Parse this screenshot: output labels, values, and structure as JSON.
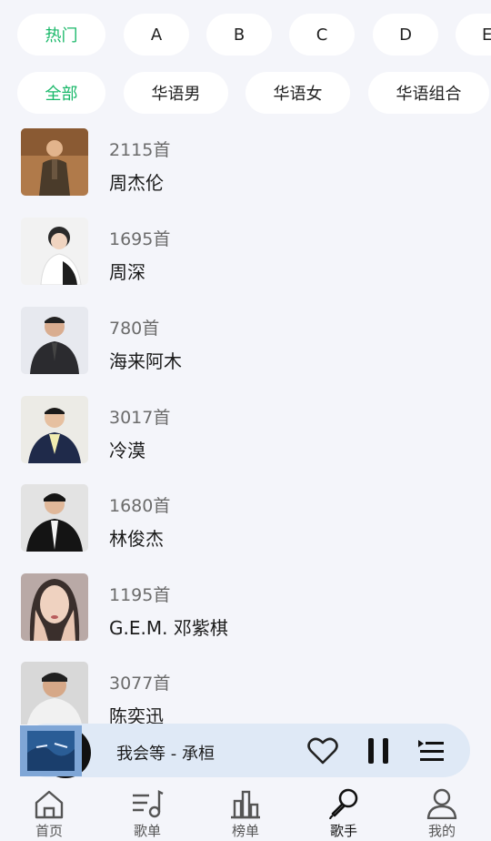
{
  "chips_row1": [
    {
      "label": "热门",
      "active": true
    },
    {
      "label": "A",
      "active": false
    },
    {
      "label": "B",
      "active": false
    },
    {
      "label": "C",
      "active": false
    },
    {
      "label": "D",
      "active": false
    },
    {
      "label": "E",
      "active": false
    }
  ],
  "chips_row2": [
    {
      "label": "全部",
      "active": true
    },
    {
      "label": "华语男",
      "active": false
    },
    {
      "label": "华语女",
      "active": false
    },
    {
      "label": "华语组合",
      "active": false
    }
  ],
  "singers": [
    {
      "count": "2115首",
      "name": "周杰伦"
    },
    {
      "count": "1695首",
      "name": "周深"
    },
    {
      "count": "780首",
      "name": "海来阿木"
    },
    {
      "count": "3017首",
      "name": "冷漠"
    },
    {
      "count": "1680首",
      "name": "林俊杰"
    },
    {
      "count": "1195首",
      "name": "G.E.M. 邓紫棋"
    },
    {
      "count": "3077首",
      "name": "陈奕迅"
    }
  ],
  "player": {
    "title": "我会等 - 承桓",
    "icons": [
      "heart-icon",
      "pause-icon",
      "playlist-icon"
    ]
  },
  "nav": [
    {
      "label": "首页",
      "icon": "home-icon",
      "active": false
    },
    {
      "label": "歌单",
      "icon": "music-list-icon",
      "active": false
    },
    {
      "label": "榜单",
      "icon": "chart-icon",
      "active": false
    },
    {
      "label": "歌手",
      "icon": "microphone-icon",
      "active": true
    },
    {
      "label": "我的",
      "icon": "user-icon",
      "active": false
    }
  ],
  "colors": {
    "accent": "#19b869",
    "background": "#f4f5fa",
    "player_bg": "#dfe9f6"
  }
}
